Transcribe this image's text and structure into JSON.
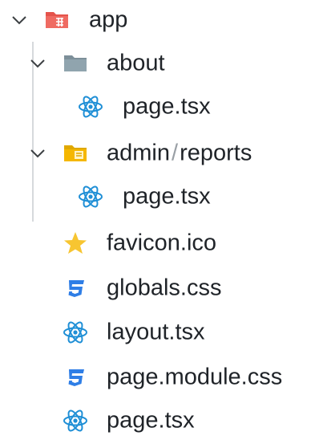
{
  "tree": {
    "app": {
      "label": "app",
      "icon": "folder-app-icon",
      "color": "#e5534b"
    },
    "about": {
      "label": "about",
      "icon": "folder-icon",
      "color": "#90a4ae"
    },
    "about_page": {
      "label": "page.tsx",
      "icon": "react-icon",
      "color": "#1f8fd6"
    },
    "admin": {
      "label_part1": "admin",
      "separator": "/",
      "label_part2": "reports",
      "icon": "folder-admin-icon",
      "color": "#f5b700"
    },
    "admin_page": {
      "label": "page.tsx",
      "icon": "react-icon",
      "color": "#1f8fd6"
    },
    "favicon": {
      "label": "favicon.ico",
      "icon": "star-icon",
      "color": "#f7c531"
    },
    "globals": {
      "label": "globals.css",
      "icon": "css-icon",
      "color": "#2f7ee6"
    },
    "layout": {
      "label": "layout.tsx",
      "icon": "react-icon",
      "color": "#1f8fd6"
    },
    "page_module": {
      "label": "page.module.css",
      "icon": "css-icon",
      "color": "#2f7ee6"
    },
    "page": {
      "label": "page.tsx",
      "icon": "react-icon",
      "color": "#1f8fd6"
    }
  }
}
